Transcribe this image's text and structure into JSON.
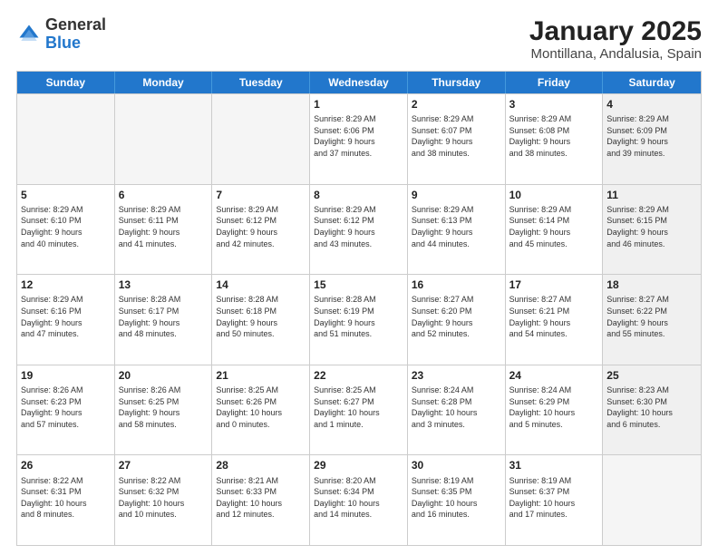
{
  "logo": {
    "general": "General",
    "blue": "Blue"
  },
  "title": "January 2025",
  "subtitle": "Montillana, Andalusia, Spain",
  "days": [
    "Sunday",
    "Monday",
    "Tuesday",
    "Wednesday",
    "Thursday",
    "Friday",
    "Saturday"
  ],
  "rows": [
    [
      {
        "num": "",
        "text": "",
        "empty": true
      },
      {
        "num": "",
        "text": "",
        "empty": true
      },
      {
        "num": "",
        "text": "",
        "empty": true
      },
      {
        "num": "1",
        "text": "Sunrise: 8:29 AM\nSunset: 6:06 PM\nDaylight: 9 hours\nand 37 minutes."
      },
      {
        "num": "2",
        "text": "Sunrise: 8:29 AM\nSunset: 6:07 PM\nDaylight: 9 hours\nand 38 minutes."
      },
      {
        "num": "3",
        "text": "Sunrise: 8:29 AM\nSunset: 6:08 PM\nDaylight: 9 hours\nand 38 minutes."
      },
      {
        "num": "4",
        "text": "Sunrise: 8:29 AM\nSunset: 6:09 PM\nDaylight: 9 hours\nand 39 minutes.",
        "shaded": true
      }
    ],
    [
      {
        "num": "5",
        "text": "Sunrise: 8:29 AM\nSunset: 6:10 PM\nDaylight: 9 hours\nand 40 minutes."
      },
      {
        "num": "6",
        "text": "Sunrise: 8:29 AM\nSunset: 6:11 PM\nDaylight: 9 hours\nand 41 minutes."
      },
      {
        "num": "7",
        "text": "Sunrise: 8:29 AM\nSunset: 6:12 PM\nDaylight: 9 hours\nand 42 minutes."
      },
      {
        "num": "8",
        "text": "Sunrise: 8:29 AM\nSunset: 6:12 PM\nDaylight: 9 hours\nand 43 minutes."
      },
      {
        "num": "9",
        "text": "Sunrise: 8:29 AM\nSunset: 6:13 PM\nDaylight: 9 hours\nand 44 minutes."
      },
      {
        "num": "10",
        "text": "Sunrise: 8:29 AM\nSunset: 6:14 PM\nDaylight: 9 hours\nand 45 minutes."
      },
      {
        "num": "11",
        "text": "Sunrise: 8:29 AM\nSunset: 6:15 PM\nDaylight: 9 hours\nand 46 minutes.",
        "shaded": true
      }
    ],
    [
      {
        "num": "12",
        "text": "Sunrise: 8:29 AM\nSunset: 6:16 PM\nDaylight: 9 hours\nand 47 minutes."
      },
      {
        "num": "13",
        "text": "Sunrise: 8:28 AM\nSunset: 6:17 PM\nDaylight: 9 hours\nand 48 minutes."
      },
      {
        "num": "14",
        "text": "Sunrise: 8:28 AM\nSunset: 6:18 PM\nDaylight: 9 hours\nand 50 minutes."
      },
      {
        "num": "15",
        "text": "Sunrise: 8:28 AM\nSunset: 6:19 PM\nDaylight: 9 hours\nand 51 minutes."
      },
      {
        "num": "16",
        "text": "Sunrise: 8:27 AM\nSunset: 6:20 PM\nDaylight: 9 hours\nand 52 minutes."
      },
      {
        "num": "17",
        "text": "Sunrise: 8:27 AM\nSunset: 6:21 PM\nDaylight: 9 hours\nand 54 minutes."
      },
      {
        "num": "18",
        "text": "Sunrise: 8:27 AM\nSunset: 6:22 PM\nDaylight: 9 hours\nand 55 minutes.",
        "shaded": true
      }
    ],
    [
      {
        "num": "19",
        "text": "Sunrise: 8:26 AM\nSunset: 6:23 PM\nDaylight: 9 hours\nand 57 minutes."
      },
      {
        "num": "20",
        "text": "Sunrise: 8:26 AM\nSunset: 6:25 PM\nDaylight: 9 hours\nand 58 minutes."
      },
      {
        "num": "21",
        "text": "Sunrise: 8:25 AM\nSunset: 6:26 PM\nDaylight: 10 hours\nand 0 minutes."
      },
      {
        "num": "22",
        "text": "Sunrise: 8:25 AM\nSunset: 6:27 PM\nDaylight: 10 hours\nand 1 minute."
      },
      {
        "num": "23",
        "text": "Sunrise: 8:24 AM\nSunset: 6:28 PM\nDaylight: 10 hours\nand 3 minutes."
      },
      {
        "num": "24",
        "text": "Sunrise: 8:24 AM\nSunset: 6:29 PM\nDaylight: 10 hours\nand 5 minutes."
      },
      {
        "num": "25",
        "text": "Sunrise: 8:23 AM\nSunset: 6:30 PM\nDaylight: 10 hours\nand 6 minutes.",
        "shaded": true
      }
    ],
    [
      {
        "num": "26",
        "text": "Sunrise: 8:22 AM\nSunset: 6:31 PM\nDaylight: 10 hours\nand 8 minutes."
      },
      {
        "num": "27",
        "text": "Sunrise: 8:22 AM\nSunset: 6:32 PM\nDaylight: 10 hours\nand 10 minutes."
      },
      {
        "num": "28",
        "text": "Sunrise: 8:21 AM\nSunset: 6:33 PM\nDaylight: 10 hours\nand 12 minutes."
      },
      {
        "num": "29",
        "text": "Sunrise: 8:20 AM\nSunset: 6:34 PM\nDaylight: 10 hours\nand 14 minutes."
      },
      {
        "num": "30",
        "text": "Sunrise: 8:19 AM\nSunset: 6:35 PM\nDaylight: 10 hours\nand 16 minutes."
      },
      {
        "num": "31",
        "text": "Sunrise: 8:19 AM\nSunset: 6:37 PM\nDaylight: 10 hours\nand 17 minutes."
      },
      {
        "num": "",
        "text": "",
        "empty": true
      }
    ]
  ]
}
